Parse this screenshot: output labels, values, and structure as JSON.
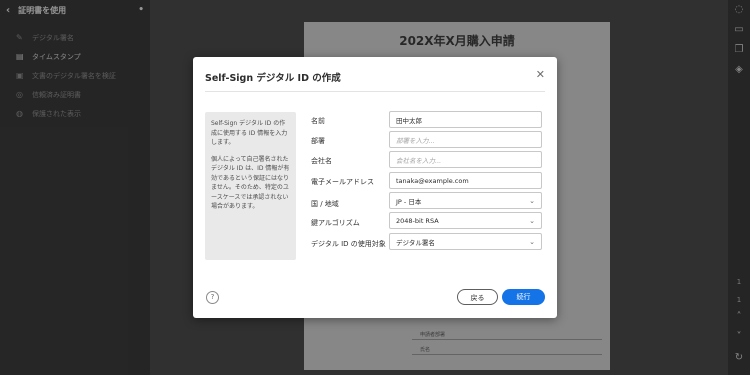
{
  "left_panel": {
    "title": "証明書を使用",
    "items": [
      {
        "label": "デジタル署名",
        "active": false
      },
      {
        "label": "タイムスタンプ",
        "active": true
      },
      {
        "label": "文書のデジタル署名を検証",
        "active": false
      },
      {
        "label": "信頼済み証明書",
        "active": false
      },
      {
        "label": "保護された表示",
        "active": false
      }
    ]
  },
  "document": {
    "title": "202X年X月購入申請",
    "labels": [
      "申請者部署",
      "氏名"
    ]
  },
  "dialog": {
    "title": "Self-Sign デジタル ID の作成",
    "info": {
      "p1": "Self-Sign デジタル ID の作成に使用する ID 情報を入力します。",
      "p2": "個人によって自己署名されたデジタル ID は、ID 情報が有効であるという保証にはなりません。そのため、特定のユースケースでは承認されない場合があります。"
    },
    "fields": {
      "name": {
        "label": "名前",
        "value": "田中太郎"
      },
      "dept": {
        "label": "部署",
        "placeholder": "部署を入力..."
      },
      "company": {
        "label": "会社名",
        "placeholder": "会社名を入力..."
      },
      "email": {
        "label": "電子メールアドレス",
        "value": "tanaka@example.com"
      },
      "country": {
        "label": "国 / 地域",
        "value": "JP - 日本"
      },
      "algorithm": {
        "label": "鍵アルゴリズム",
        "value": "2048-bit RSA"
      },
      "usage": {
        "label": "デジタル ID の使用対象",
        "value": "デジタル署名"
      }
    },
    "help": "?",
    "back_label": "戻る",
    "continue_label": "続行"
  },
  "right_rail": {
    "page_indicator": [
      "1",
      "1"
    ]
  },
  "colors": {
    "accent": "#1473e6"
  }
}
